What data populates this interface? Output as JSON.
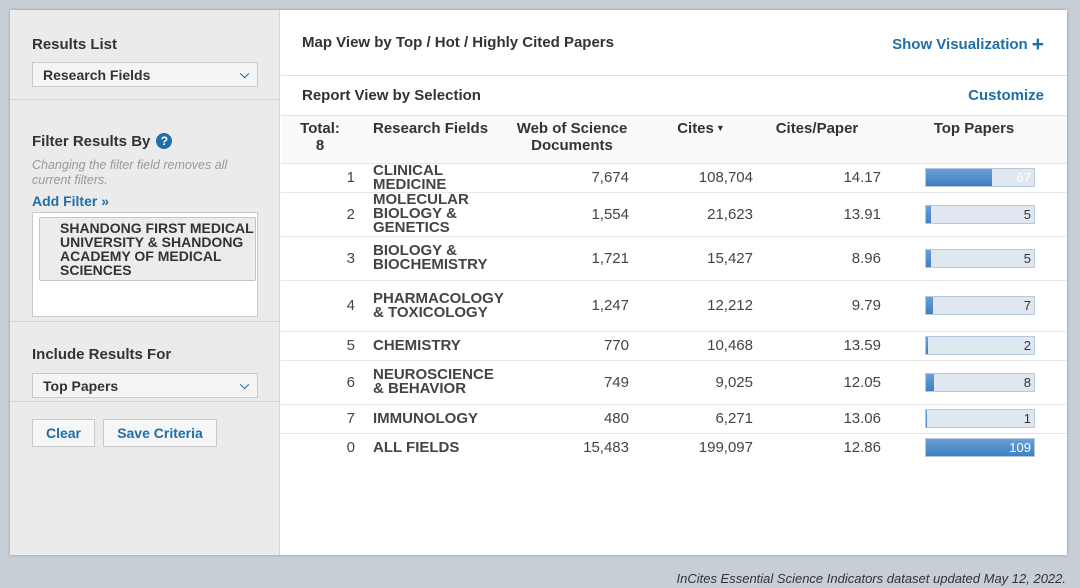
{
  "sidebar": {
    "results_list_label": "Results List",
    "results_list_value": "Research Fields",
    "filter_label": "Filter Results By",
    "filter_note": "Changing the filter field removes all current filters.",
    "add_filter": "Add Filter »",
    "filter_chip": "SHANDONG FIRST MEDICAL UNIVERSITY & SHANDONG ACADEMY OF MEDICAL SCIENCES",
    "include_label": "Include Results For",
    "include_value": "Top Papers",
    "clear_label": "Clear",
    "save_label": "Save Criteria"
  },
  "header": {
    "map_view_title": "Map View by Top / Hot / Highly Cited Papers",
    "show_visualization": "Show Visualization",
    "report_view_title": "Report View by Selection",
    "customize": "Customize"
  },
  "table": {
    "headers": {
      "total": "Total:\n8",
      "field": "Research Fields",
      "docs": "Web of Science Documents",
      "cites": "Cites",
      "cpp": "Cites/Paper",
      "top": "Top Papers"
    },
    "rows": [
      {
        "rank": "1",
        "field": "CLINICAL MEDICINE",
        "docs": "7,674",
        "cites": "108,704",
        "cpp": "14.17",
        "top": "67",
        "top_fraction": 0.615
      },
      {
        "rank": "2",
        "field": "MOLECULAR BIOLOGY & GENETICS",
        "docs": "1,554",
        "cites": "21,623",
        "cpp": "13.91",
        "top": "5",
        "top_fraction": 0.046
      },
      {
        "rank": "3",
        "field": "BIOLOGY & BIOCHEMISTRY",
        "docs": "1,721",
        "cites": "15,427",
        "cpp": "8.96",
        "top": "5",
        "top_fraction": 0.046
      },
      {
        "rank": "4",
        "field": "PHARMACOLOGY & TOXICOLOGY",
        "docs": "1,247",
        "cites": "12,212",
        "cpp": "9.79",
        "top": "7",
        "top_fraction": 0.064
      },
      {
        "rank": "5",
        "field": "CHEMISTRY",
        "docs": "770",
        "cites": "10,468",
        "cpp": "13.59",
        "top": "2",
        "top_fraction": 0.018
      },
      {
        "rank": "6",
        "field": "NEUROSCIENCE & BEHAVIOR",
        "docs": "749",
        "cites": "9,025",
        "cpp": "12.05",
        "top": "8",
        "top_fraction": 0.073
      },
      {
        "rank": "7",
        "field": "IMMUNOLOGY",
        "docs": "480",
        "cites": "6,271",
        "cpp": "13.06",
        "top": "1",
        "top_fraction": 0.009
      },
      {
        "rank": "0",
        "field": "ALL FIELDS",
        "docs": "15,483",
        "cites": "199,097",
        "cpp": "12.86",
        "top": "109",
        "top_fraction": 1.0
      }
    ]
  },
  "footer": "InCites Essential Science Indicators dataset updated May 12, 2022.",
  "colors": {
    "accent": "#1e6fa8",
    "bar_fill": "#3f7fc2",
    "bar_track": "#dfe8f1"
  }
}
